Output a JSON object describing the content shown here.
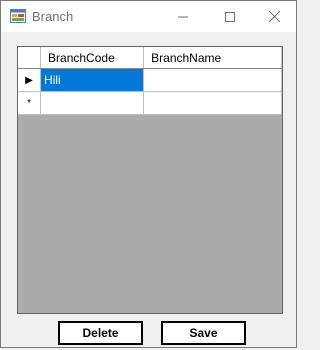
{
  "window": {
    "title": "Branch",
    "icon": "form-icon",
    "controls": [
      "minimize-icon",
      "maximize-icon",
      "close-icon"
    ]
  },
  "grid": {
    "columns": [
      "BranchCode",
      "BranchName"
    ],
    "rows": [
      {
        "indicator": "▶",
        "cells": [
          "Hili",
          ""
        ],
        "selected_cell": 0
      },
      {
        "indicator": "*",
        "cells": [
          "",
          ""
        ]
      }
    ],
    "selection_color": "#0078d7"
  },
  "buttons": {
    "delete_label": "Delete",
    "save_label": "Save"
  }
}
